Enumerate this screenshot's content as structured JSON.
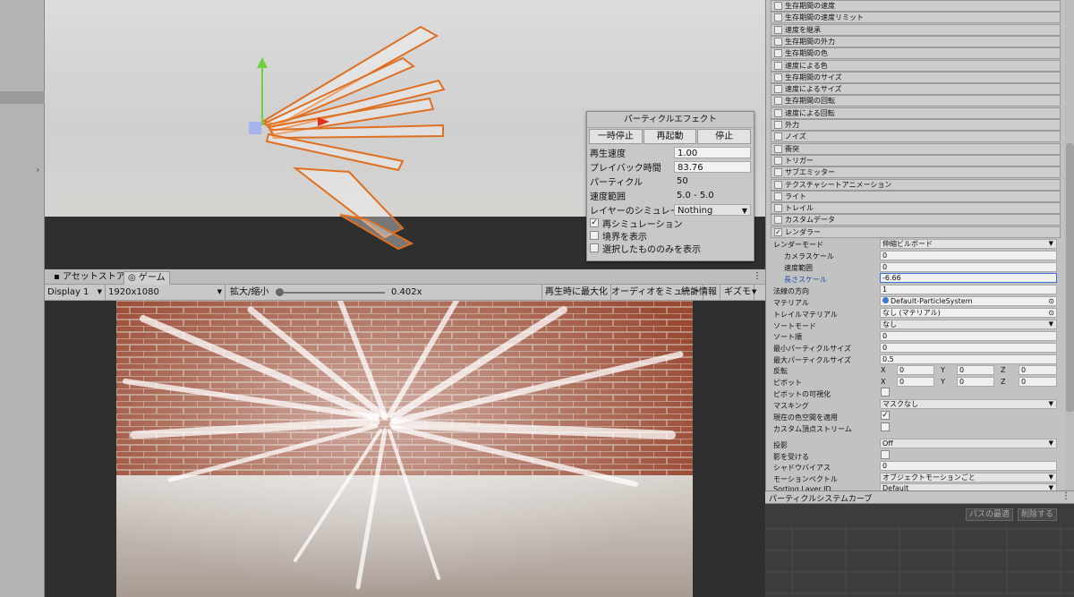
{
  "particle_effect": {
    "title": "パーティクルエフェクト",
    "buttons": [
      "一時停止",
      "再起動",
      "停止"
    ],
    "rows": [
      {
        "label": "再生速度",
        "value": "1.00",
        "box": true
      },
      {
        "label": "プレイバック時間",
        "value": "83.76",
        "box": true
      },
      {
        "label": "パーティクル",
        "value": "50",
        "box": false
      },
      {
        "label": "速度範囲",
        "value": "5.0 - 5.0",
        "box": false
      }
    ],
    "layer_sim_label": "レイヤーのシミュレーション",
    "layer_sim_value": "Nothing",
    "checks": [
      {
        "label": "再シミュレーション",
        "checked": true
      },
      {
        "label": "境界を表示",
        "checked": false
      },
      {
        "label": "選択したもののみを表示",
        "checked": false
      }
    ]
  },
  "game_tabs": {
    "asset_store": "アセットストア",
    "game": "ゲーム"
  },
  "game_toolbar": {
    "display": "Display 1",
    "resolution": "1920x1080",
    "scale_label": "拡大/縮小",
    "scale_value": "0.402x",
    "maximize": "再生時に最大化",
    "mute": "オーディオをミュート",
    "stats": "統計情報",
    "gizmos": "ギズモ"
  },
  "modules": [
    {
      "label": "生存期間の速度",
      "checked": false
    },
    {
      "label": "生存期間の速度リミット",
      "checked": false
    },
    {
      "label": "速度を継承",
      "checked": false
    },
    {
      "label": "生存期間の外力",
      "checked": false
    },
    {
      "label": "生存期間の色",
      "checked": false
    },
    {
      "label": "速度による色",
      "checked": false
    },
    {
      "label": "生存期間のサイズ",
      "checked": false
    },
    {
      "label": "速度によるサイズ",
      "checked": false
    },
    {
      "label": "生存期間の回転",
      "checked": false
    },
    {
      "label": "速度による回転",
      "checked": false
    },
    {
      "label": "外力",
      "checked": false
    },
    {
      "label": "ノイズ",
      "checked": false
    },
    {
      "label": "衝突",
      "checked": false
    },
    {
      "label": "トリガー",
      "checked": false
    },
    {
      "label": "サブエミッター",
      "checked": false
    },
    {
      "label": "テクスチャシートアニメーション",
      "checked": false
    },
    {
      "label": "ライト",
      "checked": false
    },
    {
      "label": "トレイル",
      "checked": false
    },
    {
      "label": "カスタムデータ",
      "checked": false
    },
    {
      "label": "レンダラー",
      "checked": true
    }
  ],
  "renderer": {
    "render_mode": {
      "label": "レンダーモード",
      "value": "伸縮ビルボード"
    },
    "camera_scale": {
      "label": "カメラスケール",
      "value": "0"
    },
    "speed_scale": {
      "label": "速度範囲",
      "value": "0"
    },
    "length_scale": {
      "label": "長さスケール",
      "value": "-6.66"
    },
    "normal_direction": {
      "label": "法線の方向",
      "value": "1"
    },
    "material": {
      "label": "マテリアル",
      "value": "Default-ParticleSystem"
    },
    "trail_material": {
      "label": "トレイルマテリアル",
      "value": "なし (マテリアル)"
    },
    "sort_mode": {
      "label": "ソートモード",
      "value": "なし"
    },
    "sort_order": {
      "label": "ソート順",
      "value": "0"
    },
    "min_size": {
      "label": "最小パーティクルサイズ",
      "value": "0"
    },
    "max_size": {
      "label": "最大パーティクルサイズ",
      "value": "0.5"
    },
    "flip": {
      "label": "反転",
      "x": "0",
      "y": "0",
      "z": "0"
    },
    "pivot": {
      "label": "ピボット",
      "x": "0",
      "y": "0",
      "z": "0"
    },
    "visualize_pivot": {
      "label": "ピボットの可視化"
    },
    "masking": {
      "label": "マスキング",
      "value": "マスクなし"
    },
    "apply_color_space": {
      "label": "現在の色空間を適用",
      "checked": true
    },
    "custom_vertex": {
      "label": "カスタム頂点ストリーム"
    },
    "cast_shadows": {
      "label": "投影",
      "value": "Off"
    },
    "receive_shadows": {
      "label": "影を受ける"
    },
    "shadow_bias": {
      "label": "シャドウバイアス",
      "value": "0"
    },
    "motion_vectors": {
      "label": "モーションベクトル",
      "value": "オブジェクトモーションごと"
    },
    "sorting_layer": {
      "label": "Sorting Layer ID",
      "value": "Default"
    }
  },
  "xyz": {
    "x": "X",
    "y": "Y",
    "z": "Z"
  },
  "curves": {
    "title": "パーティクルシステムカーブ",
    "optimize": "パスの最適",
    "remove": "削除する"
  }
}
